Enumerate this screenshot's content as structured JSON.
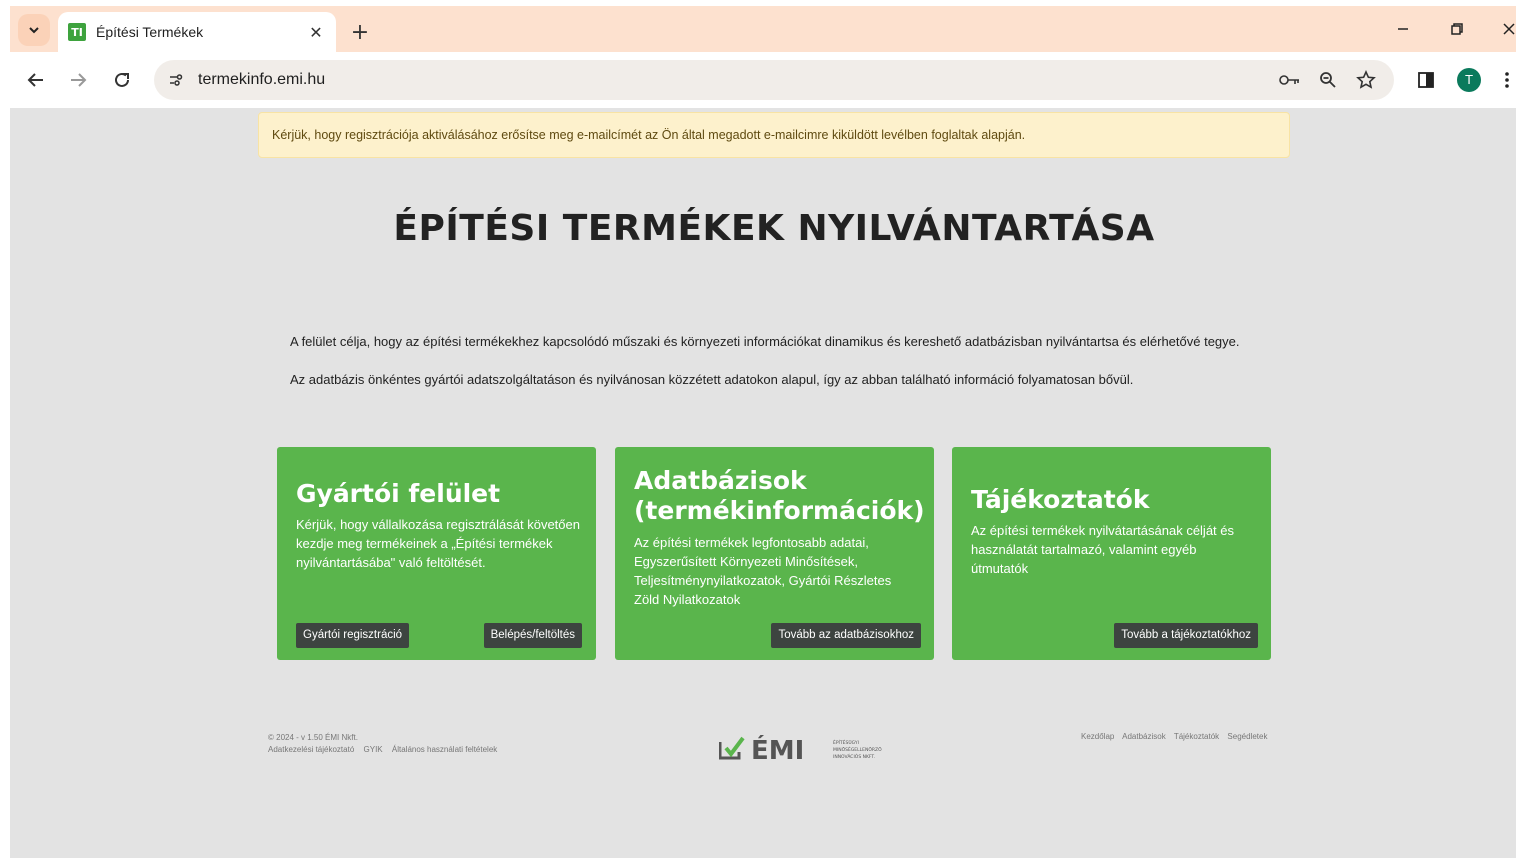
{
  "browser": {
    "tab_title": "Építési Termékek",
    "favicon_text": "TI",
    "url": "termekinfo.emi.hu",
    "profile_initial": "T"
  },
  "alert": {
    "text": "Kérjük, hogy regisztrációja aktiválásához erősítse meg e-mailcímét az Ön által megadott e-mailcimre kiküldött levélben foglaltak alapján."
  },
  "page": {
    "title": "ÉPÍTÉSI TERMÉKEK NYILVÁNTARTÁSA",
    "intro_1": "A felület célja, hogy az építési termékekhez kapcsolódó műszaki és környezeti információkat dinamikus és kereshető adatbázisban nyilvántartsa és elérhetővé tegye.",
    "intro_2": "Az adatbázis önkéntes gyártói adatszolgáltatáson és nyilvánosan közzétett adatokon alapul, így az abban található információ folyamatosan bővül."
  },
  "cards": [
    {
      "title": "Gyártói felület",
      "description": "Kérjük, hogy vállalkozása regisztrálását követően kezdje meg termékeinek a „Építési termékek nyilvántartásába\" való feltöltését.",
      "buttons": [
        "Gyártói regisztráció",
        "Belépés/feltöltés"
      ]
    },
    {
      "title": "Adatbázisok (termékinformációk)",
      "description": "Az építési termékek legfontosabb adatai, Egyszerűsített Környezeti Minősítések, Teljesítménynyilatkozatok, Gyártói Részletes Zöld Nyilatkozatok",
      "buttons": [
        "Tovább az adatbázisokhoz"
      ]
    },
    {
      "title": "Tájékoztatók",
      "description": "Az építési termékek nyilvátartásának célját és használatát tartalmazó, valamint egyéb útmutatók",
      "buttons": [
        "Tovább a tájékoztatókhoz"
      ]
    }
  ],
  "footer": {
    "copyright": "© 2024 - v 1.50 ÉMI Nkft.",
    "links_left": [
      "Adatkezelési tájékoztató",
      "GYIK",
      "Általános használati feltételek"
    ],
    "links_right": [
      "Kezdőlap",
      "Adatbázisok",
      "Tájékoztatók",
      "Segédletek"
    ],
    "logo_text": "ÉMI",
    "logo_subtext": [
      "ÉPÍTÉSÜGYI",
      "MINŐSÉGELLENŐRZŐ",
      "INNOVÁCIÓS NKFT."
    ]
  },
  "colors": {
    "card_green": "#5ab54c",
    "button_dark": "#3d4440",
    "alert_bg": "#fdf1cc",
    "chrome_bg": "#fde1cf"
  }
}
